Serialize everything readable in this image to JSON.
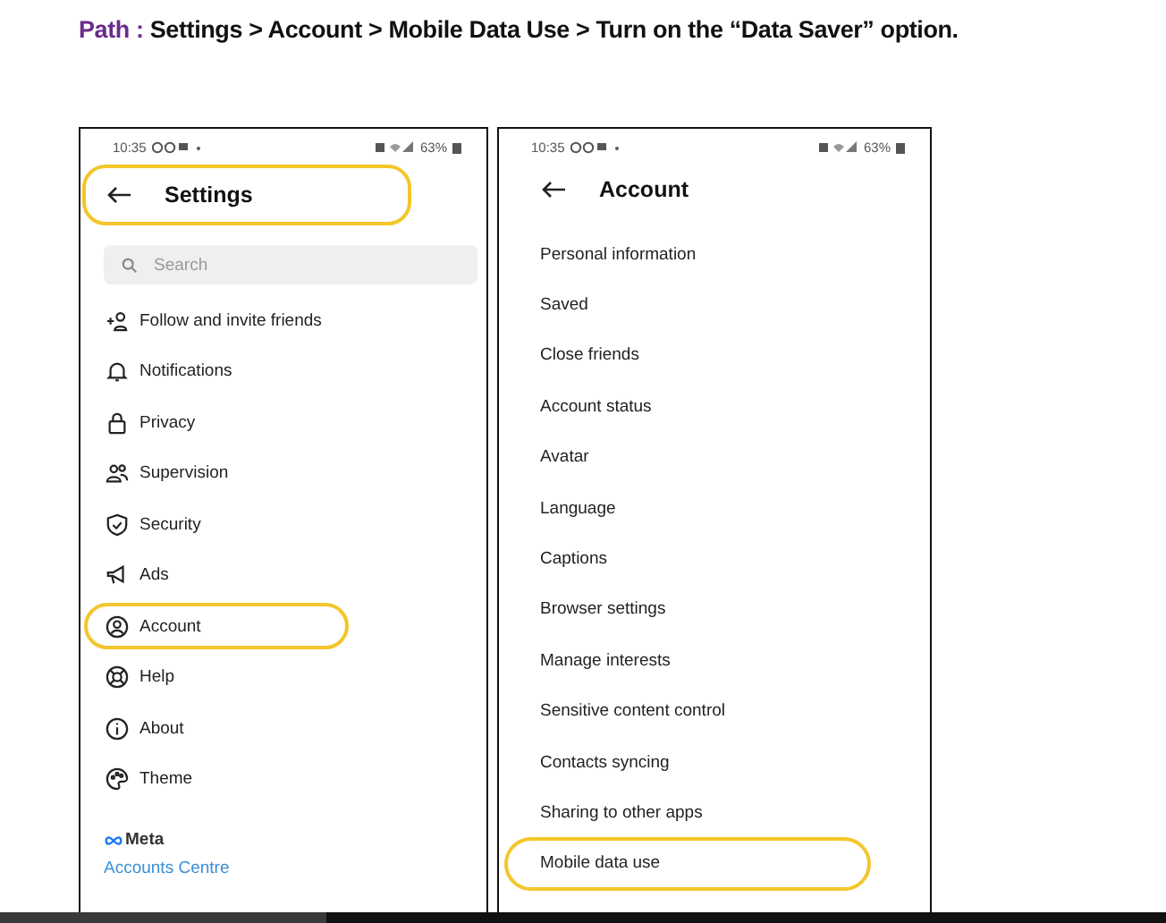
{
  "instruction": {
    "label": "Path :",
    "text": "Settings > Account > Mobile Data Use > Turn on the “Data Saver” option."
  },
  "settings_screen": {
    "status_time": "10:35",
    "battery": "63%",
    "title": "Settings",
    "title_highlighted": true,
    "search": {
      "placeholder": "Search"
    },
    "items": [
      {
        "label": "Follow and invite friends",
        "highlighted": false
      },
      {
        "label": "Notifications",
        "highlighted": false
      },
      {
        "label": "Privacy",
        "highlighted": false
      },
      {
        "label": "Supervision",
        "highlighted": false
      },
      {
        "label": "Security",
        "highlighted": false
      },
      {
        "label": "Ads",
        "highlighted": false
      },
      {
        "label": "Account",
        "highlighted": true
      },
      {
        "label": "Help",
        "highlighted": false
      },
      {
        "label": "About",
        "highlighted": false
      },
      {
        "label": "Theme",
        "highlighted": false
      }
    ],
    "footer": {
      "brand": "Meta",
      "link": "Accounts Centre"
    }
  },
  "account_screen": {
    "status_time": "10:35",
    "battery": "63%",
    "title": "Account",
    "items": [
      {
        "label": "Personal information",
        "highlighted": false
      },
      {
        "label": "Saved",
        "highlighted": false
      },
      {
        "label": "Close friends",
        "highlighted": false
      },
      {
        "label": "Account status",
        "highlighted": false
      },
      {
        "label": "Avatar",
        "highlighted": false
      },
      {
        "label": "Language",
        "highlighted": false
      },
      {
        "label": "Captions",
        "highlighted": false
      },
      {
        "label": "Browser settings",
        "highlighted": false
      },
      {
        "label": "Manage interests",
        "highlighted": false
      },
      {
        "label": "Sensitive content control",
        "highlighted": false
      },
      {
        "label": "Contacts syncing",
        "highlighted": false
      },
      {
        "label": "Sharing to other apps",
        "highlighted": false
      },
      {
        "label": "Mobile data use",
        "highlighted": true
      }
    ]
  }
}
